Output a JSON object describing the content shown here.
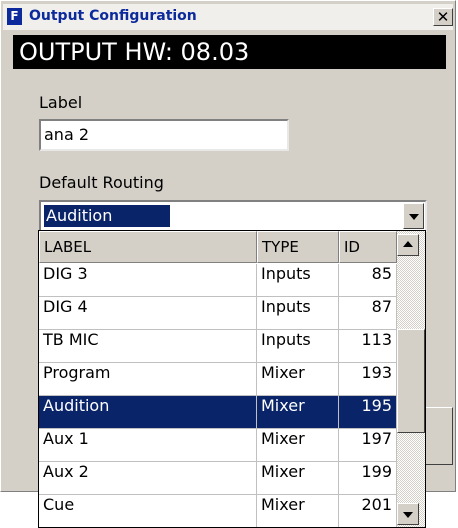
{
  "window": {
    "title": "Output Configuration",
    "icon_letter": "F",
    "close_glyph": "✕"
  },
  "banner": {
    "text": "OUTPUT HW: 08.03"
  },
  "label_field": {
    "caption": "Label",
    "value": "ana 2"
  },
  "routing": {
    "caption": "Default Routing",
    "selected": "Audition"
  },
  "list": {
    "columns": [
      "LABEL",
      "TYPE",
      "ID"
    ],
    "rows": [
      {
        "label": "DIG 3",
        "type": "Inputs",
        "id": "85"
      },
      {
        "label": "DIG 4",
        "type": "Inputs",
        "id": "87"
      },
      {
        "label": "TB MIC",
        "type": "Inputs",
        "id": "113"
      },
      {
        "label": "Program",
        "type": "Mixer",
        "id": "193"
      },
      {
        "label": "Audition",
        "type": "Mixer",
        "id": "195",
        "selected": true
      },
      {
        "label": "Aux 1",
        "type": "Mixer",
        "id": "197"
      },
      {
        "label": "Aux 2",
        "type": "Mixer",
        "id": "199"
      },
      {
        "label": "Cue",
        "type": "Mixer",
        "id": "201"
      }
    ]
  },
  "icons": [
    "app-icon",
    "close-icon",
    "dropdown-arrow-icon",
    "scroll-up-icon",
    "scroll-down-icon"
  ],
  "colors": {
    "selection": "#0a246a",
    "title_text": "#0c2a9c",
    "face": "#d4d0c8"
  }
}
